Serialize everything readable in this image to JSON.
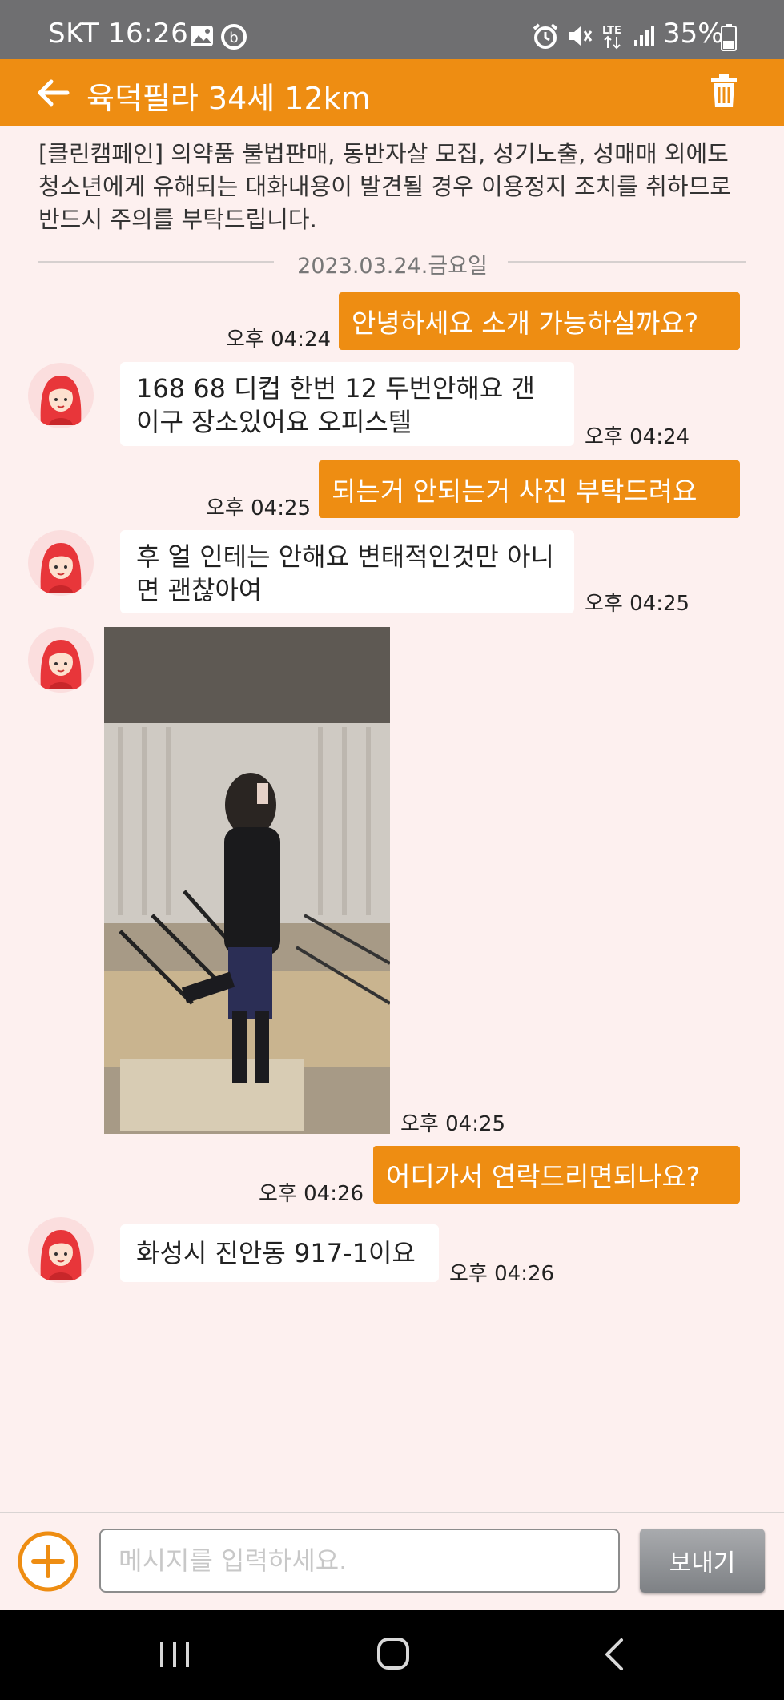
{
  "status_bar": {
    "carrier": "SKT",
    "time": "16:26",
    "battery": "35%",
    "icons": [
      "gallery-icon",
      "sync-icon",
      "alarm-icon",
      "mute-icon",
      "lte-icon",
      "signal-icon",
      "battery-icon"
    ]
  },
  "header": {
    "title": "육덕필라 34세 12km",
    "icons": [
      "back-arrow-icon",
      "trash-icon"
    ],
    "color": "#ee8d12"
  },
  "notice": "[클린캠페인] 의약품 불법판매, 동반자살 모집, 성기노출, 성매매 외에도 청소년에게 유해되는 대화내용이 발견될 경우 이용정지 조치를 취하므로 반드시 주의를 부탁드립니다.",
  "date_divider": "2023.03.24.금요일",
  "messages": [
    {
      "dir": "out",
      "text": "안녕하세요 소개 가능하실까요?",
      "time": "오후 04:24"
    },
    {
      "dir": "in",
      "text": "168 68 디컵 한번 12 두번안해요 갠이구 장소있어요 오피스텔",
      "time": "오후 04:24"
    },
    {
      "dir": "out",
      "text": "되는거 안되는거 사진 부탁드려요",
      "time": "오후 04:25"
    },
    {
      "dir": "in",
      "text": "후 얼 인테는 안해요 변태적인것만 아니면 괜찮아여",
      "time": "오후 04:25"
    },
    {
      "dir": "in",
      "type": "photo",
      "time": "오후 04:25"
    },
    {
      "dir": "out",
      "text": "어디가서 연락드리면되나요?",
      "time": "오후 04:26"
    },
    {
      "dir": "in",
      "text": "화성시 진안동 917-1이요",
      "time": "오후 04:26"
    }
  ],
  "input": {
    "placeholder": "메시지를 입력하세요.",
    "value": ""
  },
  "send_label": "보내기",
  "nav_icons": [
    "recent-apps-icon",
    "home-icon",
    "back-icon"
  ]
}
